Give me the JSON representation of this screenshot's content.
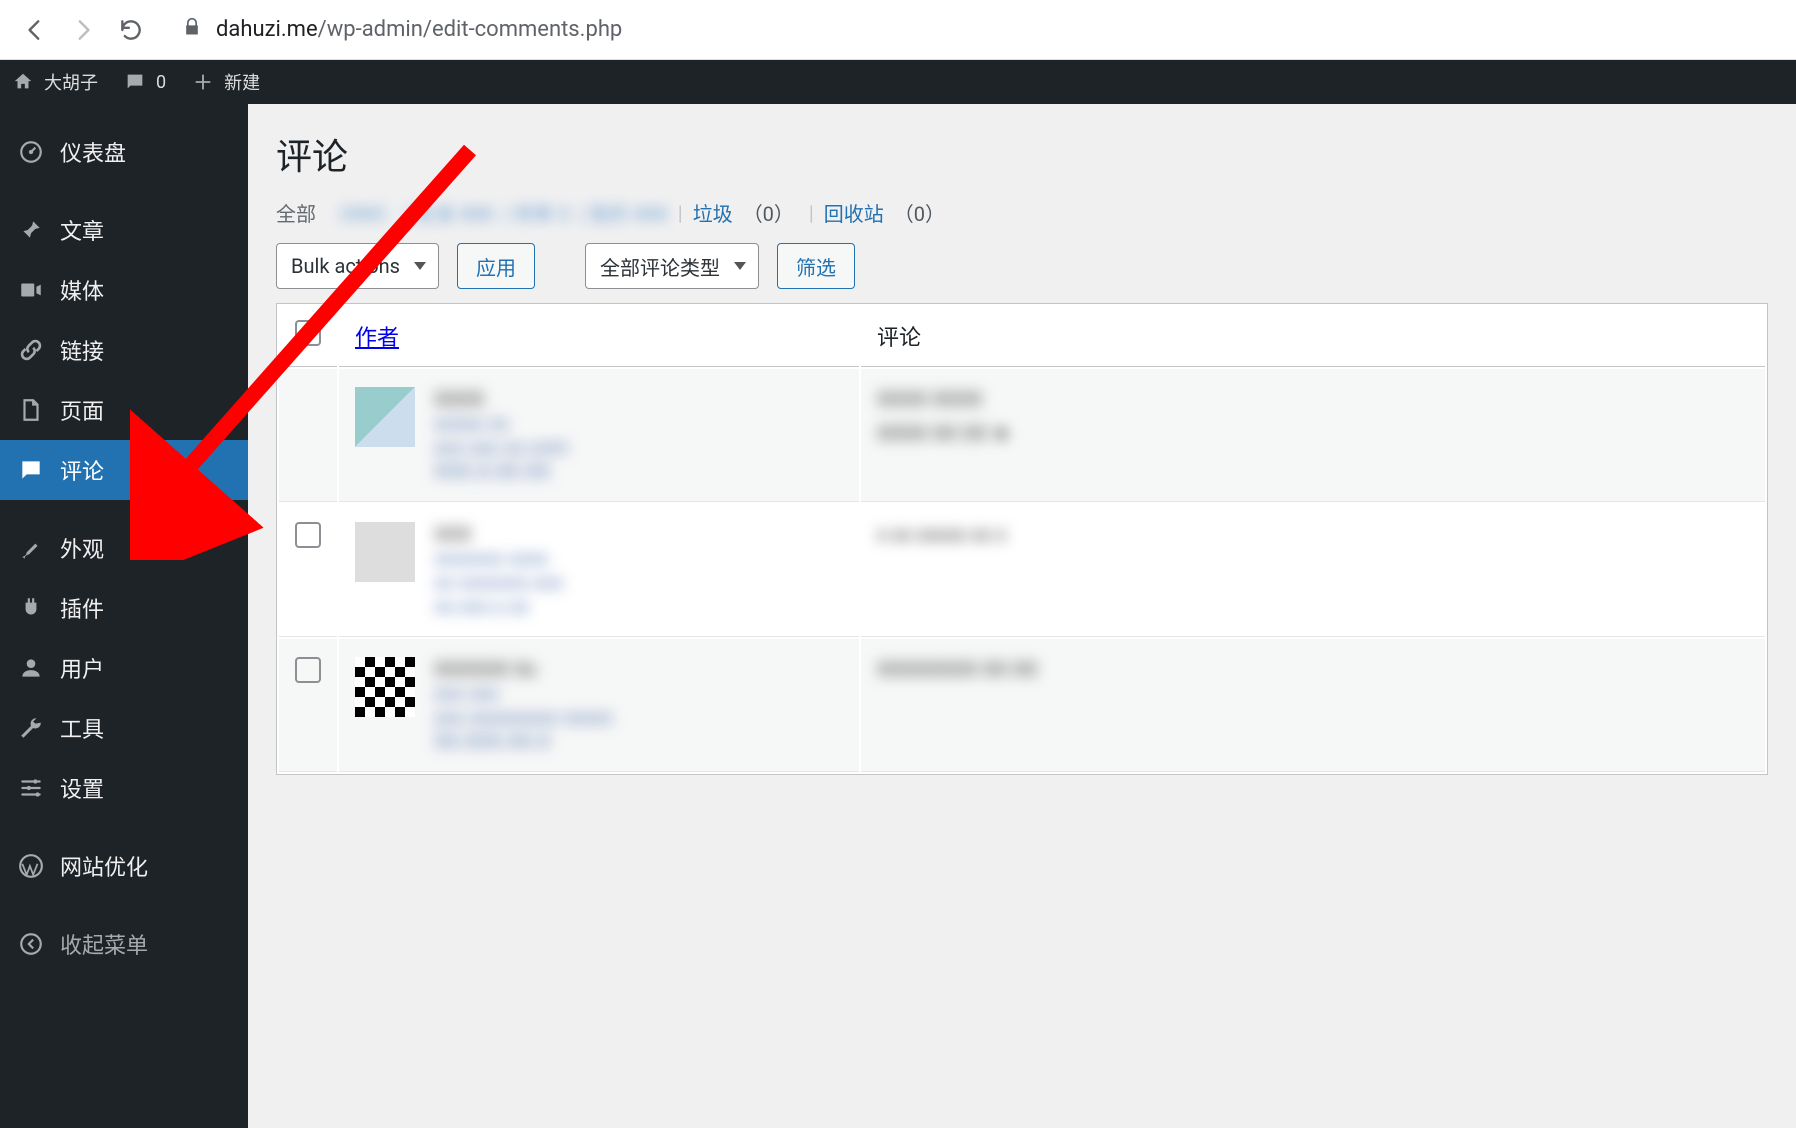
{
  "browser": {
    "url_host": "dahuzi.me",
    "url_path": "/wp-admin/edit-comments.php"
  },
  "adminbar": {
    "site_name": "大胡子",
    "comment_count": "0",
    "new_label": "新建"
  },
  "sidebar": {
    "dashboard": "仪表盘",
    "posts": "文章",
    "media": "媒体",
    "links": "链接",
    "pages": "页面",
    "comments": "评论",
    "appearance": "外观",
    "plugins": "插件",
    "users": "用户",
    "tools": "工具",
    "settings": "设置",
    "site_opt": "网站优化",
    "collapse": "收起菜单"
  },
  "page": {
    "title": "评论",
    "filters": {
      "all_label": "全部",
      "spam_label": "垃圾",
      "spam_count": "（0）",
      "trash_label": "回收站",
      "trash_count": "（0）"
    },
    "bulk_label": "Bulk actions",
    "apply_label": "应用",
    "type_label": "全部评论类型",
    "filter_label": "筛选",
    "columns": {
      "author": "作者",
      "comment": "评论"
    }
  }
}
